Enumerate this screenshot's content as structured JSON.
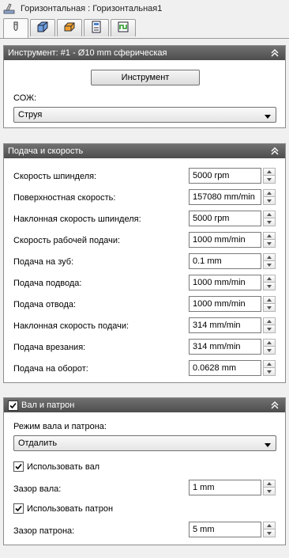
{
  "title": "Горизонтальная : Горизонтальная1",
  "tabs": [
    {
      "icon": "tool-icon",
      "active": true
    },
    {
      "icon": "geometry-icon",
      "active": false
    },
    {
      "icon": "heights-icon",
      "active": false
    },
    {
      "icon": "passes-icon",
      "active": false
    },
    {
      "icon": "linking-icon",
      "active": false
    }
  ],
  "tool": {
    "header": "Инструмент: #1 - Ø10 mm сферическая",
    "button": "Инструмент",
    "coolant_label": "СОЖ:",
    "coolant_value": "Струя"
  },
  "feeds": {
    "header": "Подача и скорость",
    "rows": [
      {
        "label": "Скорость шпинделя:",
        "value": "5000 rpm"
      },
      {
        "label": "Поверхностная скорость:",
        "value": "157080 mm/min"
      },
      {
        "label": "Наклонная скорость шпинделя:",
        "value": "5000 rpm"
      },
      {
        "label": "Скорость рабочей подачи:",
        "value": "1000 mm/min"
      },
      {
        "label": "Подача на зуб:",
        "value": "0.1 mm"
      },
      {
        "label": "Подача подвода:",
        "value": "1000 mm/min"
      },
      {
        "label": "Подача отвода:",
        "value": "1000 mm/min"
      },
      {
        "label": "Наклонная скорость подачи:",
        "value": "314 mm/min"
      },
      {
        "label": "Подача врезания:",
        "value": "314 mm/min"
      },
      {
        "label": "Подача на оборот:",
        "value": "0.0628 mm"
      }
    ]
  },
  "shaft": {
    "header": "Вал и патрон",
    "header_checked": true,
    "mode_label": "Режим вала и патрона:",
    "mode_value": "Отдалить",
    "use_shaft_label": "Использовать вал",
    "use_shaft_checked": true,
    "shaft_clearance_label": "Зазор вала:",
    "shaft_clearance_value": "1 mm",
    "use_holder_label": "Использовать патрон",
    "use_holder_checked": true,
    "holder_clearance_label": "Зазор патрона:",
    "holder_clearance_value": "5 mm"
  }
}
